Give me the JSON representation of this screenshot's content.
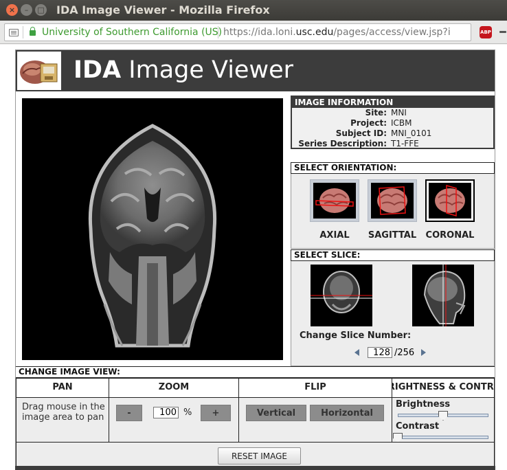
{
  "window": {
    "title": "IDA Image Viewer - Mozilla Firefox"
  },
  "urlbar": {
    "org": "University of Southern California (US)",
    "url_prefix": "https://ida.loni.",
    "url_domain": "usc.edu",
    "url_path": "/pages/access/view.jsp?i",
    "adblock_label": "ABP"
  },
  "app": {
    "title_bold": "IDA",
    "title_rest": " Image Viewer"
  },
  "image_info": {
    "header": "IMAGE INFORMATION",
    "rows": [
      {
        "key": "Site:",
        "value": "MNI"
      },
      {
        "key": "Project:",
        "value": "ICBM"
      },
      {
        "key": "Subject ID:",
        "value": "MNI_0101"
      },
      {
        "key": "Series Description:",
        "value": "T1-FFE"
      }
    ]
  },
  "orientation": {
    "header": "SELECT ORIENTATION:",
    "options": [
      "AXIAL",
      "SAGITTAL",
      "CORONAL"
    ],
    "selected": "CORONAL"
  },
  "slice": {
    "header": "SELECT SLICE:",
    "label": "Change Slice Number:",
    "value": "128",
    "total": "/256"
  },
  "view": {
    "header": "CHANGE IMAGE VIEW:",
    "pan": {
      "title": "PAN",
      "text": "Drag mouse in the image area to pan"
    },
    "zoom": {
      "title": "ZOOM",
      "minus": "-",
      "value": "100",
      "unit": "%",
      "plus": "+"
    },
    "flip": {
      "title": "FLIP",
      "vertical": "Vertical",
      "horizontal": "Horizontal"
    },
    "bc": {
      "title": "BRIGHTNESS & CONTRAST",
      "brightness_label": "Brightness",
      "contrast_label": "Contrast",
      "brightness_value": 0.5,
      "contrast_value": 0.0
    }
  },
  "reset_label": "RESET IMAGE",
  "colors": {
    "header_bg": "#3c3c3c",
    "accent_green": "#3d9a2f",
    "close_button": "#f0724b"
  }
}
